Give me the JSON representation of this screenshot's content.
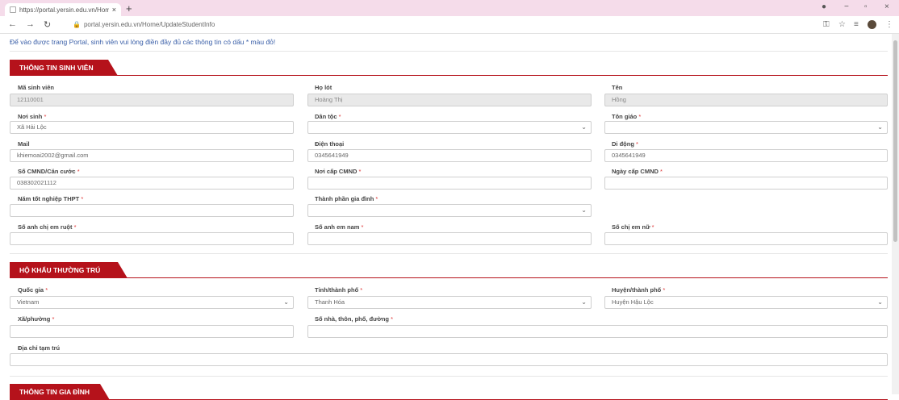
{
  "browser": {
    "tab_title": "https://portal.yersin.edu.vn/Hom",
    "url": "portal.yersin.edu.vn/Home/UpdateStudentInfo",
    "new_tab": "+",
    "close_tab": "×"
  },
  "notice": "Để vào được trang Portal, sinh viên vui lòng điền đầy đủ các thông tin có dấu * màu đỏ!",
  "sections": {
    "student_info": "THÔNG TIN SINH VIÊN",
    "residence": "HỘ KHẨU THƯỜNG TRÚ",
    "family": "THÔNG TIN GIA ĐÌNH"
  },
  "required_mark": "*",
  "fields": {
    "ma_sinh_vien": {
      "label": "Mã sinh viên",
      "value": "12110001"
    },
    "ho_lot": {
      "label": "Họ lót",
      "value": "Hoàng Thị"
    },
    "ten": {
      "label": "Tên",
      "value": "Hồng"
    },
    "noi_sinh": {
      "label": "Nơi sinh",
      "value": "Xã Hải Lộc"
    },
    "dan_toc": {
      "label": "Dân tộc",
      "value": ""
    },
    "ton_giao": {
      "label": "Tôn giáo",
      "value": ""
    },
    "mail": {
      "label": "Mail",
      "value": "khiemoai2002@gmail.com"
    },
    "dien_thoai": {
      "label": "Điện thoại",
      "value": "0345641949"
    },
    "di_dong": {
      "label": "Di động",
      "value": "0345641949"
    },
    "cmnd": {
      "label": "Số CMND/Căn cước",
      "value": "038302021112"
    },
    "noi_cap": {
      "label": "Nơi cấp CMND",
      "value": ""
    },
    "ngay_cap": {
      "label": "Ngày cấp CMND",
      "value": ""
    },
    "nam_tot_nghiep": {
      "label": "Năm tốt nghiệp THPT",
      "value": ""
    },
    "thanh_phan": {
      "label": "Thành phần gia đình",
      "value": ""
    },
    "so_anh_chi_em": {
      "label": "Số anh chị em ruột",
      "value": ""
    },
    "so_anh_em_nam": {
      "label": "Số anh em nam",
      "value": ""
    },
    "so_chi_em_nu": {
      "label": "Số chị em nữ",
      "value": ""
    },
    "quoc_gia": {
      "label": "Quốc gia",
      "value": "Vietnam"
    },
    "tinh": {
      "label": "Tỉnh/thành phố",
      "value": "Thanh Hóa"
    },
    "huyen": {
      "label": "Huyện/thành phố",
      "value": "Huyện Hậu Lộc"
    },
    "xa": {
      "label": "Xã/phường",
      "value": ""
    },
    "so_nha": {
      "label": "Số nhà, thôn, phố, đường",
      "value": ""
    },
    "dia_chi_tam_tru": {
      "label": "Địa chỉ tạm trú",
      "value": ""
    }
  }
}
